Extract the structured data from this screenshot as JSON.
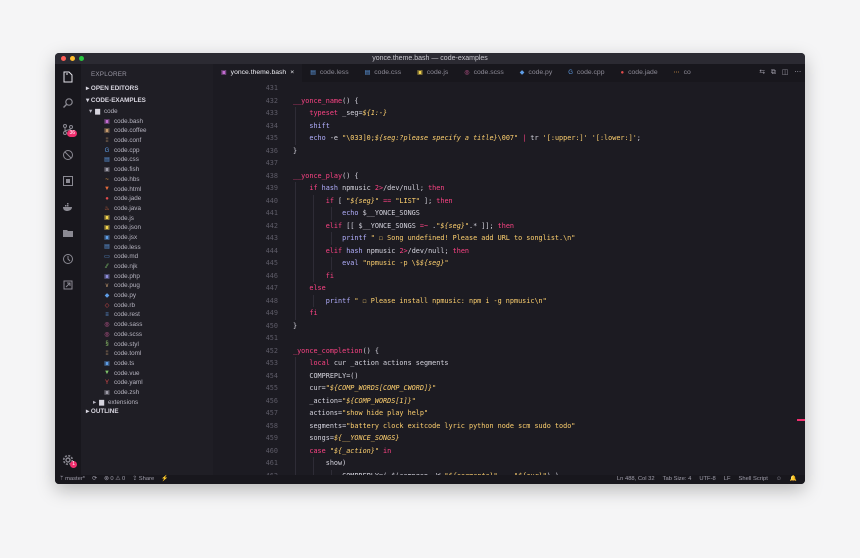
{
  "window": {
    "title": "yonce.theme.bash — code-examples"
  },
  "colors": {
    "close": "#ff5f57",
    "minimize": "#febc2e",
    "maximize": "#28c840",
    "accent": "#fc4384"
  },
  "activity": {
    "icons": [
      "files-icon",
      "search-icon",
      "source-control-icon",
      "extensions-disabled-icon",
      "remote-explorer-icon",
      "docker-icon",
      "folder-icon",
      "git-graph-icon",
      "live-share-icon"
    ],
    "scm_badge": "36",
    "settings_badge": "1"
  },
  "sidebar": {
    "title": "EXPLORER",
    "open_editors": "OPEN EDITORS",
    "project": "CODE-EXAMPLES",
    "folder": "code",
    "files": [
      {
        "name": "code.bash",
        "icon": "▣",
        "color": "#c36bd2"
      },
      {
        "name": "code.coffee",
        "icon": "▣",
        "color": "#c59a6d"
      },
      {
        "name": "code.conf",
        "icon": "⁞⁞",
        "color": "#c59a6d"
      },
      {
        "name": "code.cpp",
        "icon": "G",
        "color": "#5e9de6"
      },
      {
        "name": "code.css",
        "icon": "▤",
        "color": "#5e9de6"
      },
      {
        "name": "code.fish",
        "icon": "▣",
        "color": "#9e9ca8"
      },
      {
        "name": "code.hbs",
        "icon": "~",
        "color": "#e8a24a"
      },
      {
        "name": "code.html",
        "icon": "▼",
        "color": "#e46b3c"
      },
      {
        "name": "code.jade",
        "icon": "●",
        "color": "#e04b4b"
      },
      {
        "name": "code.java",
        "icon": "♨",
        "color": "#e46b3c"
      },
      {
        "name": "code.js",
        "icon": "▣",
        "color": "#f2d34d"
      },
      {
        "name": "code.json",
        "icon": "▣",
        "color": "#f2d34d"
      },
      {
        "name": "code.jsx",
        "icon": "▣",
        "color": "#5e9de6"
      },
      {
        "name": "code.less",
        "icon": "▤",
        "color": "#5e9de6"
      },
      {
        "name": "code.md",
        "icon": "▭",
        "color": "#5e9de6"
      },
      {
        "name": "code.njk",
        "icon": "⁄⁄",
        "color": "#7ec46a"
      },
      {
        "name": "code.php",
        "icon": "▣",
        "color": "#8c8cd9"
      },
      {
        "name": "code.pug",
        "icon": "∨",
        "color": "#c59a6d"
      },
      {
        "name": "code.py",
        "icon": "◆",
        "color": "#5e9de6"
      },
      {
        "name": "code.rb",
        "icon": "◇",
        "color": "#e04b4b"
      },
      {
        "name": "code.rest",
        "icon": "≡",
        "color": "#5e9de6"
      },
      {
        "name": "code.sass",
        "icon": "◎",
        "color": "#d45c9b"
      },
      {
        "name": "code.scss",
        "icon": "◎",
        "color": "#d45c9b"
      },
      {
        "name": "code.styl",
        "icon": "§",
        "color": "#8fc46a"
      },
      {
        "name": "code.toml",
        "icon": "⁞⁞",
        "color": "#c59a6d"
      },
      {
        "name": "code.ts",
        "icon": "▣",
        "color": "#5e9de6"
      },
      {
        "name": "code.vue",
        "icon": "▼",
        "color": "#7ec46a"
      },
      {
        "name": "code.yaml",
        "icon": "Y",
        "color": "#e04b4b"
      },
      {
        "name": "code.zsh",
        "icon": "▣",
        "color": "#9e9ca8"
      }
    ],
    "extensions_folder": "extensions",
    "outline": "OUTLINE"
  },
  "tabs": [
    {
      "label": "yonce.theme.bash",
      "icon": "▣",
      "color": "#c36bd2",
      "active": true,
      "close": "×"
    },
    {
      "label": "code.less",
      "icon": "▤",
      "color": "#5e9de6"
    },
    {
      "label": "code.css",
      "icon": "▤",
      "color": "#5e9de6"
    },
    {
      "label": "code.js",
      "icon": "▣",
      "color": "#f2d34d"
    },
    {
      "label": "code.scss",
      "icon": "◎",
      "color": "#d45c9b"
    },
    {
      "label": "code.py",
      "icon": "◆",
      "color": "#5e9de6"
    },
    {
      "label": "code.cpp",
      "icon": "G",
      "color": "#5e9de6"
    },
    {
      "label": "code.jade",
      "icon": "●",
      "color": "#e04b4b"
    },
    {
      "label": "co",
      "icon": "⋯",
      "color": "#e8a24a"
    }
  ],
  "tab_actions": [
    "⇆",
    "⧉",
    "◫",
    "⋯"
  ],
  "code_lines": [
    {
      "n": "431",
      "indent": 0,
      "tokens": [
        [
          "c-pl",
          ""
        ]
      ]
    },
    {
      "n": "432",
      "indent": 0,
      "tokens": [
        [
          "c-fn",
          "__yonce_name"
        ],
        [
          "c-pl",
          "() {"
        ]
      ]
    },
    {
      "n": "433",
      "indent": 1,
      "tokens": [
        [
          "c-kw",
          "typeset"
        ],
        [
          "c-pl",
          " _seg="
        ],
        [
          "c-var",
          "${1:-}"
        ]
      ]
    },
    {
      "n": "434",
      "indent": 1,
      "tokens": [
        [
          "c-cmd",
          "shift"
        ]
      ]
    },
    {
      "n": "435",
      "indent": 1,
      "tokens": [
        [
          "c-cmd",
          "echo"
        ],
        [
          "c-pl",
          " -e "
        ],
        [
          "c-str",
          "\"\\033]0;"
        ],
        [
          "c-var",
          "${seg:?please specify a title}"
        ],
        [
          "c-str",
          "\\007\""
        ],
        [
          "c-pl",
          " "
        ],
        [
          "c-op",
          "|"
        ],
        [
          "c-pl",
          " tr "
        ],
        [
          "c-str",
          "'[:upper:]'"
        ],
        [
          "c-pl",
          " "
        ],
        [
          "c-str",
          "'[:lower:]'"
        ],
        [
          "c-pl",
          ";"
        ]
      ]
    },
    {
      "n": "436",
      "indent": 0,
      "tokens": [
        [
          "c-pl",
          "}"
        ]
      ]
    },
    {
      "n": "437",
      "indent": 0,
      "tokens": [
        [
          "c-pl",
          ""
        ]
      ]
    },
    {
      "n": "438",
      "indent": 0,
      "tokens": [
        [
          "c-fn",
          "__yonce_play"
        ],
        [
          "c-pl",
          "() {"
        ]
      ]
    },
    {
      "n": "439",
      "indent": 1,
      "tokens": [
        [
          "c-kw",
          "if"
        ],
        [
          "c-pl",
          " "
        ],
        [
          "c-cmd",
          "hash"
        ],
        [
          "c-pl",
          " npmusic "
        ],
        [
          "c-op",
          "2>"
        ],
        [
          "c-pl",
          "/dev/null; "
        ],
        [
          "c-kw",
          "then"
        ]
      ]
    },
    {
      "n": "440",
      "indent": 2,
      "tokens": [
        [
          "c-kw",
          "if"
        ],
        [
          "c-pl",
          " [ "
        ],
        [
          "c-str",
          "\""
        ],
        [
          "c-var",
          "${seg}"
        ],
        [
          "c-str",
          "\""
        ],
        [
          "c-pl",
          " "
        ],
        [
          "c-op",
          "=="
        ],
        [
          "c-pl",
          " "
        ],
        [
          "c-str",
          "\"LIST\""
        ],
        [
          "c-pl",
          " ]; "
        ],
        [
          "c-kw",
          "then"
        ]
      ]
    },
    {
      "n": "441",
      "indent": 3,
      "tokens": [
        [
          "c-cmd",
          "echo"
        ],
        [
          "c-pl",
          " $__YONCE_SONGS"
        ]
      ]
    },
    {
      "n": "442",
      "indent": 2,
      "tokens": [
        [
          "c-kw",
          "elif"
        ],
        [
          "c-pl",
          " [[ $__YONCE_SONGS "
        ],
        [
          "c-op",
          "=~"
        ],
        [
          "c-pl",
          " ."
        ],
        [
          "c-str",
          "\""
        ],
        [
          "c-var",
          "${seg}"
        ],
        [
          "c-str",
          "\""
        ],
        [
          "c-pl",
          ".* ]]; "
        ],
        [
          "c-kw",
          "then"
        ]
      ]
    },
    {
      "n": "443",
      "indent": 3,
      "tokens": [
        [
          "c-cmd",
          "printf"
        ],
        [
          "c-str",
          " \" ☐ Song undefined! Please add URL to songlist.\\n\""
        ]
      ]
    },
    {
      "n": "444",
      "indent": 2,
      "tokens": [
        [
          "c-kw",
          "elif"
        ],
        [
          "c-pl",
          " "
        ],
        [
          "c-cmd",
          "hash"
        ],
        [
          "c-pl",
          " npmusic "
        ],
        [
          "c-op",
          "2>"
        ],
        [
          "c-pl",
          "/dev/null; "
        ],
        [
          "c-kw",
          "then"
        ]
      ]
    },
    {
      "n": "445",
      "indent": 3,
      "tokens": [
        [
          "c-cmd",
          "eval"
        ],
        [
          "c-str",
          " \"npmusic -p \\$"
        ],
        [
          "c-var",
          "${seg}"
        ],
        [
          "c-str",
          "\""
        ]
      ]
    },
    {
      "n": "446",
      "indent": 2,
      "tokens": [
        [
          "c-kw",
          "fi"
        ]
      ]
    },
    {
      "n": "447",
      "indent": 1,
      "tokens": [
        [
          "c-kw",
          "else"
        ]
      ]
    },
    {
      "n": "448",
      "indent": 2,
      "tokens": [
        [
          "c-cmd",
          "printf"
        ],
        [
          "c-str",
          " \" ☐ Please install npmusic: npm i -g npmusic\\n\""
        ]
      ]
    },
    {
      "n": "449",
      "indent": 1,
      "tokens": [
        [
          "c-kw",
          "fi"
        ]
      ]
    },
    {
      "n": "450",
      "indent": 0,
      "tokens": [
        [
          "c-pl",
          "}"
        ]
      ]
    },
    {
      "n": "451",
      "indent": 0,
      "tokens": [
        [
          "c-pl",
          ""
        ]
      ]
    },
    {
      "n": "452",
      "indent": 0,
      "tokens": [
        [
          "c-fn",
          "_yonce_completion"
        ],
        [
          "c-pl",
          "() {"
        ]
      ]
    },
    {
      "n": "453",
      "indent": 1,
      "tokens": [
        [
          "c-kw",
          "local"
        ],
        [
          "c-pl",
          " cur _action actions segments"
        ]
      ]
    },
    {
      "n": "454",
      "indent": 1,
      "tokens": [
        [
          "c-pl",
          "COMPREPLY=()"
        ]
      ]
    },
    {
      "n": "455",
      "indent": 1,
      "tokens": [
        [
          "c-pl",
          "cur="
        ],
        [
          "c-str",
          "\""
        ],
        [
          "c-var",
          "${COMP_WORDS[COMP_CWORD]}"
        ],
        [
          "c-str",
          "\""
        ]
      ]
    },
    {
      "n": "456",
      "indent": 1,
      "tokens": [
        [
          "c-pl",
          "_action="
        ],
        [
          "c-str",
          "\""
        ],
        [
          "c-var",
          "${COMP_WORDS[1]}"
        ],
        [
          "c-str",
          "\""
        ]
      ]
    },
    {
      "n": "457",
      "indent": 1,
      "tokens": [
        [
          "c-pl",
          "actions="
        ],
        [
          "c-str",
          "\"show hide play help\""
        ]
      ]
    },
    {
      "n": "458",
      "indent": 1,
      "tokens": [
        [
          "c-pl",
          "segments="
        ],
        [
          "c-str",
          "\"battery clock exitcode lyric python node scm sudo todo\""
        ]
      ]
    },
    {
      "n": "459",
      "indent": 1,
      "tokens": [
        [
          "c-pl",
          "songs="
        ],
        [
          "c-var",
          "${__YONCE_SONGS}"
        ]
      ]
    },
    {
      "n": "460",
      "indent": 1,
      "tokens": [
        [
          "c-kw",
          "case"
        ],
        [
          "c-pl",
          " "
        ],
        [
          "c-str",
          "\""
        ],
        [
          "c-var",
          "${_action}"
        ],
        [
          "c-str",
          "\""
        ],
        [
          "c-pl",
          " "
        ],
        [
          "c-kw",
          "in"
        ]
      ]
    },
    {
      "n": "461",
      "indent": 2,
      "tokens": [
        [
          "c-pl",
          "show)"
        ]
      ]
    },
    {
      "n": "462",
      "indent": 3,
      "tokens": [
        [
          "c-pl",
          "COMPREPLY=( $(compgen -W "
        ],
        [
          "c-str",
          "\""
        ],
        [
          "c-var",
          "${segments}"
        ],
        [
          "c-str",
          "\""
        ],
        [
          "c-pl",
          " -- "
        ],
        [
          "c-str",
          "\""
        ],
        [
          "c-var",
          "${cur}"
        ],
        [
          "c-str",
          "\""
        ],
        [
          "c-pl",
          ") )"
        ]
      ]
    }
  ],
  "status": {
    "branch": "master*",
    "sync": "⟳",
    "problems": "⊗ 0 ⚠ 0",
    "share": "Share",
    "bolt": "⚡",
    "position": "Ln 488, Col 32",
    "tab_size": "Tab Size: 4",
    "encoding": "UTF-8",
    "eol": "LF",
    "language": "Shell Script",
    "feedback": "☺",
    "bell": "🔔"
  }
}
